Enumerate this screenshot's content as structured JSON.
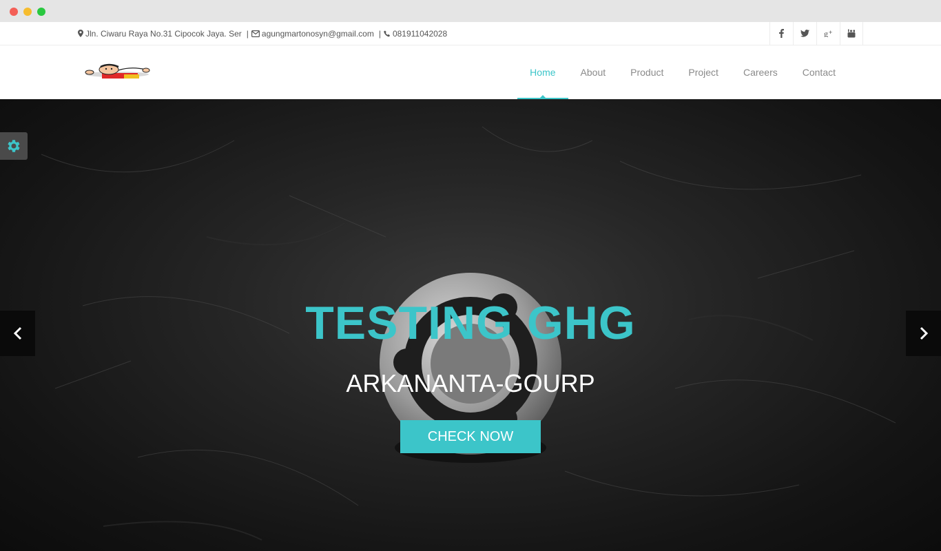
{
  "window": {
    "controls": [
      "close",
      "minimize",
      "maximize"
    ]
  },
  "topbar": {
    "address": "Jln. Ciwaru Raya No.31 Cipocok Jaya. Ser",
    "email": "agungmartonosyn@gmail.com",
    "phone": "081911042028",
    "address_icon": "map-marker-icon",
    "email_icon": "envelope-icon",
    "phone_icon": "phone-icon",
    "social": [
      "facebook-icon",
      "twitter-icon",
      "google-plus-icon",
      "youtube-icon"
    ]
  },
  "header": {
    "logo": "logo-image",
    "nav": [
      {
        "label": "Home",
        "active": true
      },
      {
        "label": "About",
        "active": false
      },
      {
        "label": "Product",
        "active": false
      },
      {
        "label": "Project",
        "active": false
      },
      {
        "label": "Careers",
        "active": false
      },
      {
        "label": "Contact",
        "active": false
      }
    ]
  },
  "hero": {
    "title": "TESTING GHG",
    "subtitle": "ARKANANTA-GOURP",
    "button": "CHECK NOW",
    "prev_icon": "chevron-left-icon",
    "next_icon": "chevron-right-icon",
    "settings_icon": "gear-icon"
  },
  "colors": {
    "accent": "#3cc5c9",
    "nav_text": "#8a8a8a",
    "hero_bg": "#1a1a1a"
  }
}
